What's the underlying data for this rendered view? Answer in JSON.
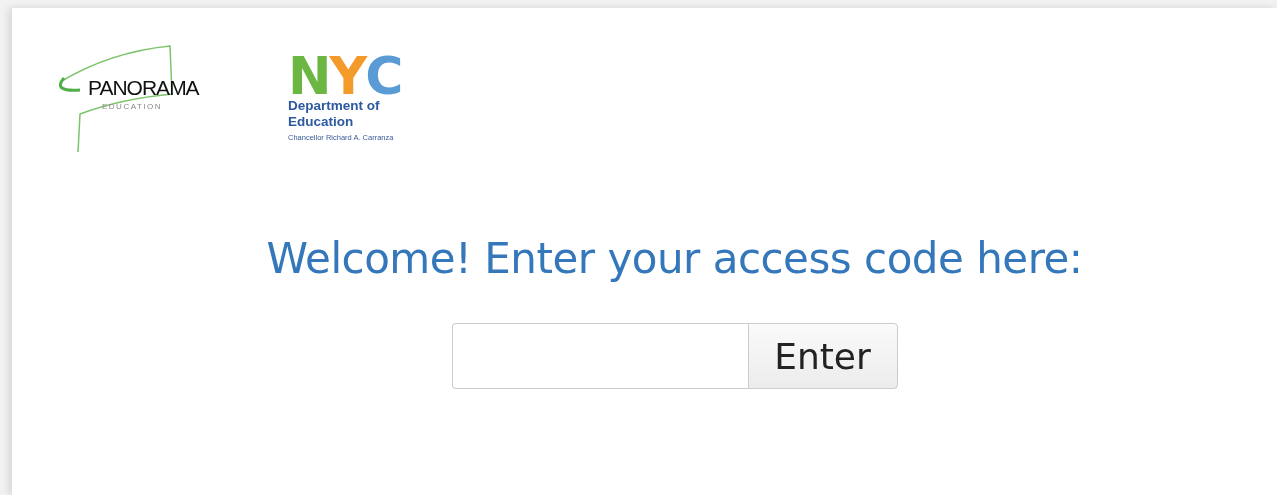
{
  "logos": {
    "panorama": {
      "name": "PANORAMA",
      "tagline": "EDUCATION"
    },
    "nyc": {
      "letters": [
        {
          "text": "N",
          "color": "#6cb644"
        },
        {
          "text": "Y",
          "color": "#f39a2b"
        },
        {
          "text": "C",
          "color": "#5b9bd5"
        }
      ],
      "title_lines": [
        "Department of",
        "Education"
      ],
      "subtitle": "Chancellor Richard A. Carranza"
    }
  },
  "heading": "Welcome! Enter your access code here:",
  "form": {
    "button": "Enter"
  }
}
